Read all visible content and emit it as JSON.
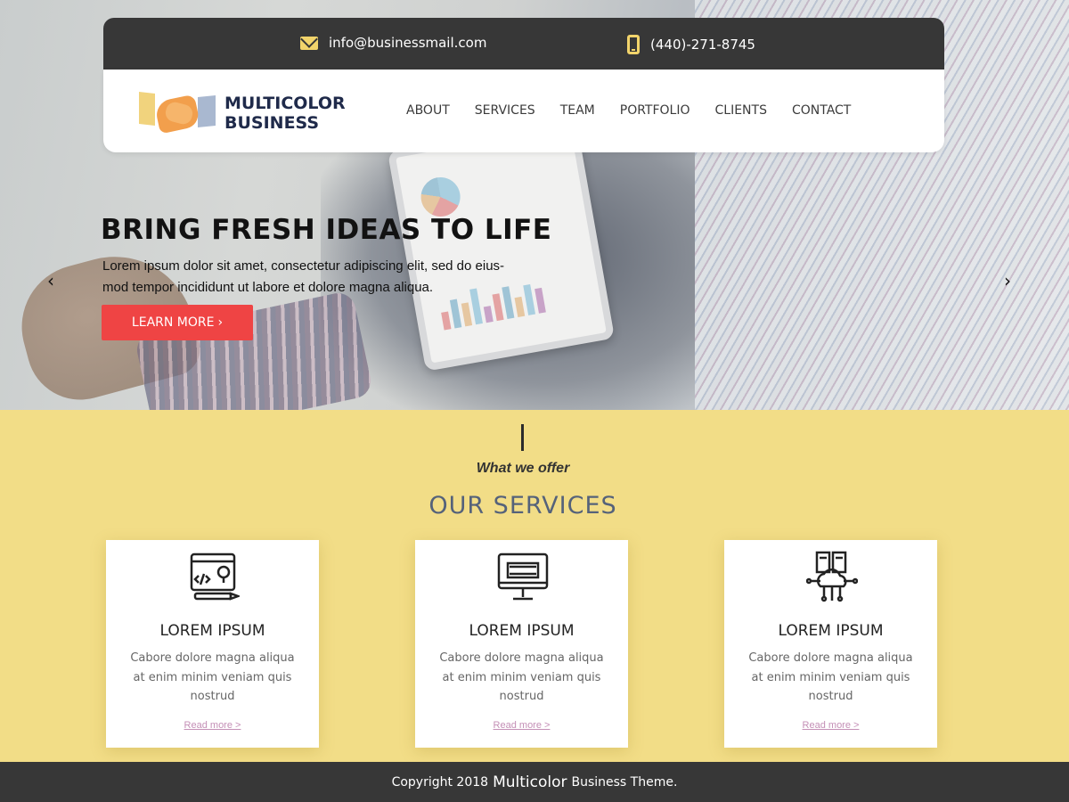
{
  "colors": {
    "topbar": "#373737",
    "accent_yellow": "#f2dd87",
    "button_red": "#ef4444",
    "link_pink": "#c48fb6",
    "nav_blue": "#1f2a4a",
    "services_title": "#55627a"
  },
  "topbar": {
    "email": "info@businessmail.com",
    "email_icon": "mail-icon",
    "phone": "(440)-271-8745",
    "phone_icon": "phone-icon"
  },
  "logo": {
    "line1": "MULTICOLOR",
    "line2": "BUSINESS",
    "icon": "handshake-icon"
  },
  "nav": {
    "items": [
      {
        "label": "ABOUT"
      },
      {
        "label": "SERVICES"
      },
      {
        "label": "TEAM"
      },
      {
        "label": "PORTFOLIO"
      },
      {
        "label": "CLIENTS"
      },
      {
        "label": "CONTACT"
      }
    ]
  },
  "hero": {
    "title": "BRING FRESH IDEAS TO LIFE",
    "description": "Lorem ipsum dolor sit amet, consectetur adipiscing elit, sed do eius-mod tempor incididunt ut labore et dolore magna aliqua.",
    "button_label": "LEARN MORE",
    "button_icon": "chevron-right-icon",
    "prev_icon": "chevron-left-icon",
    "next_icon": "chevron-right-icon"
  },
  "services": {
    "subtitle": "What we offer",
    "title": "OUR SERVICES",
    "cards": [
      {
        "icon": "web-design-icon",
        "title": "LOREM IPSUM",
        "text": "Cabore dolore magna aliqua at enim minim veniam quis nostrud",
        "link": "Read more >"
      },
      {
        "icon": "monitor-icon",
        "title": "LOREM IPSUM",
        "text": "Cabore dolore magna aliqua at enim minim veniam quis nostrud",
        "link": "Read more >"
      },
      {
        "icon": "cloud-server-icon",
        "title": "LOREM IPSUM",
        "text": "Cabore dolore magna aliqua at enim minim veniam quis nostrud",
        "link": "Read more >"
      }
    ]
  },
  "footer": {
    "prefix": "Copyright 2018",
    "brand": "Multicolor",
    "suffix": "Business Theme."
  }
}
